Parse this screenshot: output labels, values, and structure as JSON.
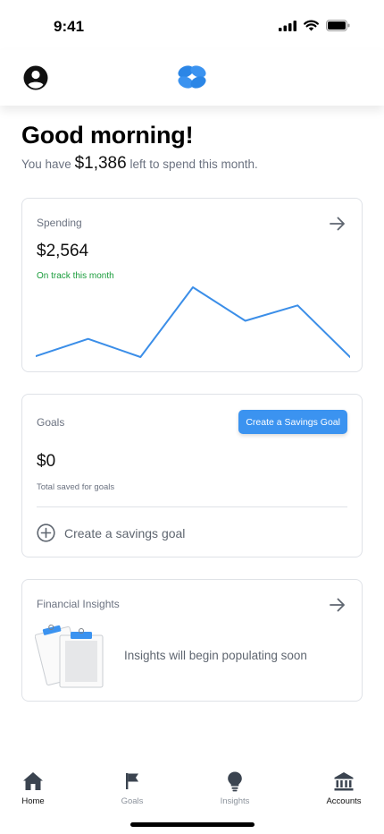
{
  "status_bar": {
    "time": "9:41"
  },
  "header": {
    "profile_icon": "account-circle-icon",
    "logo_icon": "app-logo-icon"
  },
  "greeting": {
    "title": "Good morning!",
    "prefix": "You have",
    "amount": "$1,386",
    "suffix": "left to spend this month."
  },
  "spending": {
    "title": "Spending",
    "amount": "$2,564",
    "status": "On track this month",
    "status_color": "#1a9d3c",
    "line_color": "#3b8ee8",
    "trend": [
      1,
      20,
      0,
      77,
      40,
      57,
      0
    ],
    "arrow_icon": "arrow-right-icon"
  },
  "goals": {
    "title": "Goals",
    "button_label": "Create a Savings Goal",
    "button_color": "#3b93f0",
    "amount": "$0",
    "caption": "Total saved for goals",
    "add_label": "Create a savings goal",
    "add_icon": "plus-circle-icon"
  },
  "insights": {
    "title": "Financial Insights",
    "message": "Insights will begin populating soon",
    "arrow_icon": "arrow-right-icon",
    "illustration": "clipboard-illustration"
  },
  "tabs": [
    {
      "label": "Home",
      "icon": "home-icon",
      "active": true
    },
    {
      "label": "Goals",
      "icon": "flag-icon",
      "active": false
    },
    {
      "label": "Insights",
      "icon": "lightbulb-icon",
      "active": false
    },
    {
      "label": "Accounts",
      "icon": "bank-icon",
      "active": true
    }
  ]
}
